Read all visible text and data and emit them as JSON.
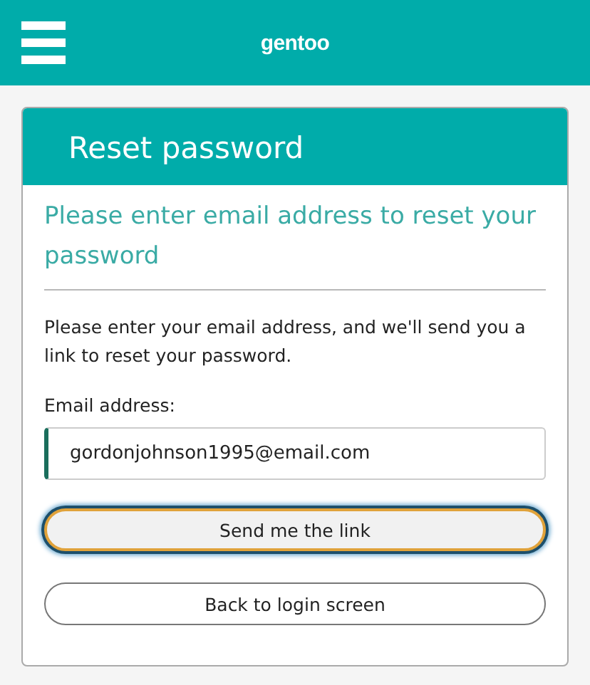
{
  "header": {
    "logo": "gentoo"
  },
  "card": {
    "title": "Reset password",
    "subtitle": "Please enter email address to reset your password",
    "description": "Please enter your email address, and we'll send you a link to reset your password.",
    "email_field": {
      "label": "Email address:",
      "value": "gordonjohnson1995@email.com"
    },
    "buttons": [
      {
        "label": "Send me the link",
        "focused": true
      },
      {
        "label": "Back to login screen",
        "focused": false
      }
    ]
  }
}
